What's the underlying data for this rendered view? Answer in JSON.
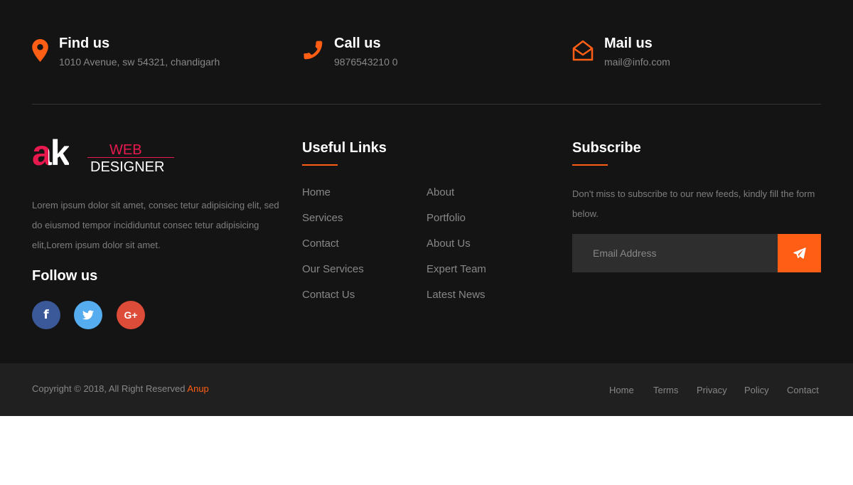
{
  "contact_cards": [
    {
      "title": "Find us",
      "text": "1010 Avenue, sw 54321, chandigarh",
      "icon": "map-marker-icon"
    },
    {
      "title": "Call us",
      "text": "9876543210 0",
      "icon": "phone-icon"
    },
    {
      "title": "Mail us",
      "text": "mail@info.com",
      "icon": "envelope-open-icon"
    }
  ],
  "logo": {
    "mark": "ak",
    "line1": "WEB",
    "line2": "DESIGNER"
  },
  "about_text": "Lorem ipsum dolor sit amet, consec tetur adipisicing elit, sed do eiusmod tempor incididuntut consec tetur adipisicing elit,Lorem ipsum dolor sit amet.",
  "follow_title": "Follow us",
  "social": [
    {
      "icon": "facebook-icon",
      "glyph": "f",
      "color": "#3b5998"
    },
    {
      "icon": "twitter-icon",
      "glyph": "🐦",
      "color": "#55acee"
    },
    {
      "icon": "google-plus-icon",
      "glyph": "G+",
      "color": "#dd4b39"
    }
  ],
  "useful_links": {
    "title": "Useful Links",
    "col1": [
      "Home",
      "Services",
      "Contact",
      "Our Services",
      "Contact Us"
    ],
    "col2": [
      "About",
      "Portfolio",
      "About Us",
      "Expert Team",
      "Latest News"
    ]
  },
  "subscribe": {
    "title": "Subscribe",
    "text": "Don't miss to subscribe to our new feeds, kindly fill the form below.",
    "placeholder": "Email Address"
  },
  "copyright": {
    "text": "Copyright © 2018, All Right Reserved ",
    "author": "Anup"
  },
  "footer_menu": [
    "Home",
    "Terms",
    "Privacy",
    "Policy",
    "Contact"
  ],
  "colors": {
    "accent": "#ff5e14",
    "background": "#151414",
    "bottom_bar": "#202020",
    "logo_red": "#e8194e"
  }
}
